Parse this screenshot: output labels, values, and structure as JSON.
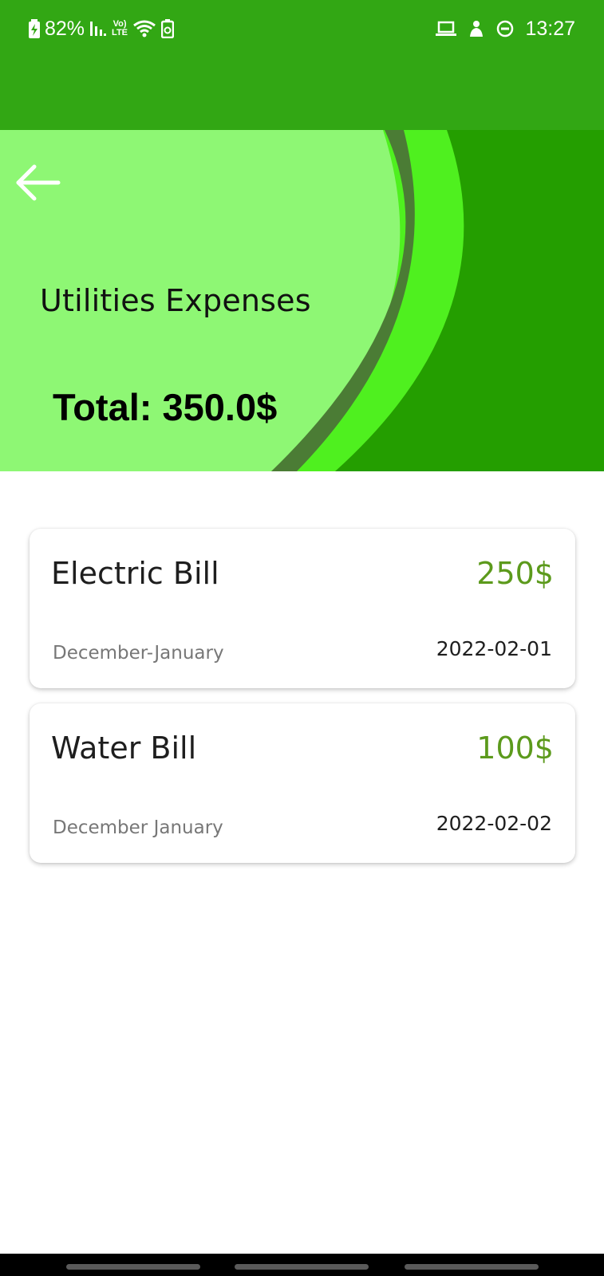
{
  "status_bar": {
    "battery_percent": "82%",
    "time": "13:27",
    "left_icons": [
      "battery-charging-icon",
      "signal-icon",
      "volte-icon",
      "wifi-icon",
      "battery-saver-icon"
    ],
    "right_icons": [
      "laptop-icon",
      "sleep-icon",
      "do-not-disturb-icon"
    ],
    "volte_top": "Vo)",
    "volte_bottom": "LTE"
  },
  "header": {
    "title": "Utilities Expenses",
    "total": "Total: 350.0$",
    "back_icon": "arrow-left-icon"
  },
  "expenses": [
    {
      "name": "Electric Bill",
      "amount": "250$",
      "period": "December-January",
      "date": "2022-02-01"
    },
    {
      "name": "Water Bill",
      "amount": "100$",
      "period": "December January",
      "date": "2022-02-02"
    }
  ],
  "colors": {
    "app_bar": "#32a714",
    "header_light": "#8ef774",
    "header_dark": "#249e00",
    "accent_swoosh": "#4ff01f",
    "dark_swoosh": "#4b7c35",
    "amount": "#5c9a1c"
  }
}
